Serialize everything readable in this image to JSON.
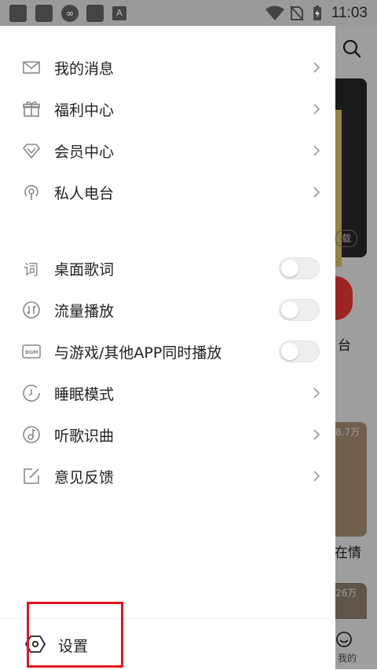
{
  "status_bar": {
    "time": "11:03",
    "icons": [
      "app-icon",
      "app-icon",
      "infinity-icon",
      "app-icon",
      "a-icon",
      "wifi-icon",
      "no-sim-icon",
      "battery-charging-icon"
    ]
  },
  "background": {
    "tag_text": "载",
    "radio_label": "台",
    "thumb1_count": "8.7万",
    "qing_label": "在情",
    "thumb2_count": "26万",
    "tab_label": "我的"
  },
  "menu": {
    "group1": [
      {
        "label": "我的消息",
        "icon": "mail-icon"
      },
      {
        "label": "福利中心",
        "icon": "gift-icon"
      },
      {
        "label": "会员中心",
        "icon": "diamond-icon"
      },
      {
        "label": "私人电台",
        "icon": "radio-icon"
      }
    ],
    "group2": [
      {
        "label": "桌面歌词",
        "icon": "lyrics-icon",
        "type": "toggle",
        "on": false
      },
      {
        "label": "流量播放",
        "icon": "data-icon",
        "type": "toggle",
        "on": false
      },
      {
        "label": "与游戏/其他APP同时播放",
        "icon": "bgm-icon",
        "type": "toggle",
        "on": false
      },
      {
        "label": "睡眠模式",
        "icon": "clock-icon",
        "type": "chevron"
      },
      {
        "label": "听歌识曲",
        "icon": "music-note-icon",
        "type": "chevron"
      },
      {
        "label": "意见反馈",
        "icon": "feedback-icon",
        "type": "chevron"
      }
    ]
  },
  "settings": {
    "label": "设置",
    "icon": "settings-icon"
  },
  "colors": {
    "highlight": "#e5141a",
    "toggle_off": "#eeeeee",
    "icon_gray": "#888888"
  }
}
